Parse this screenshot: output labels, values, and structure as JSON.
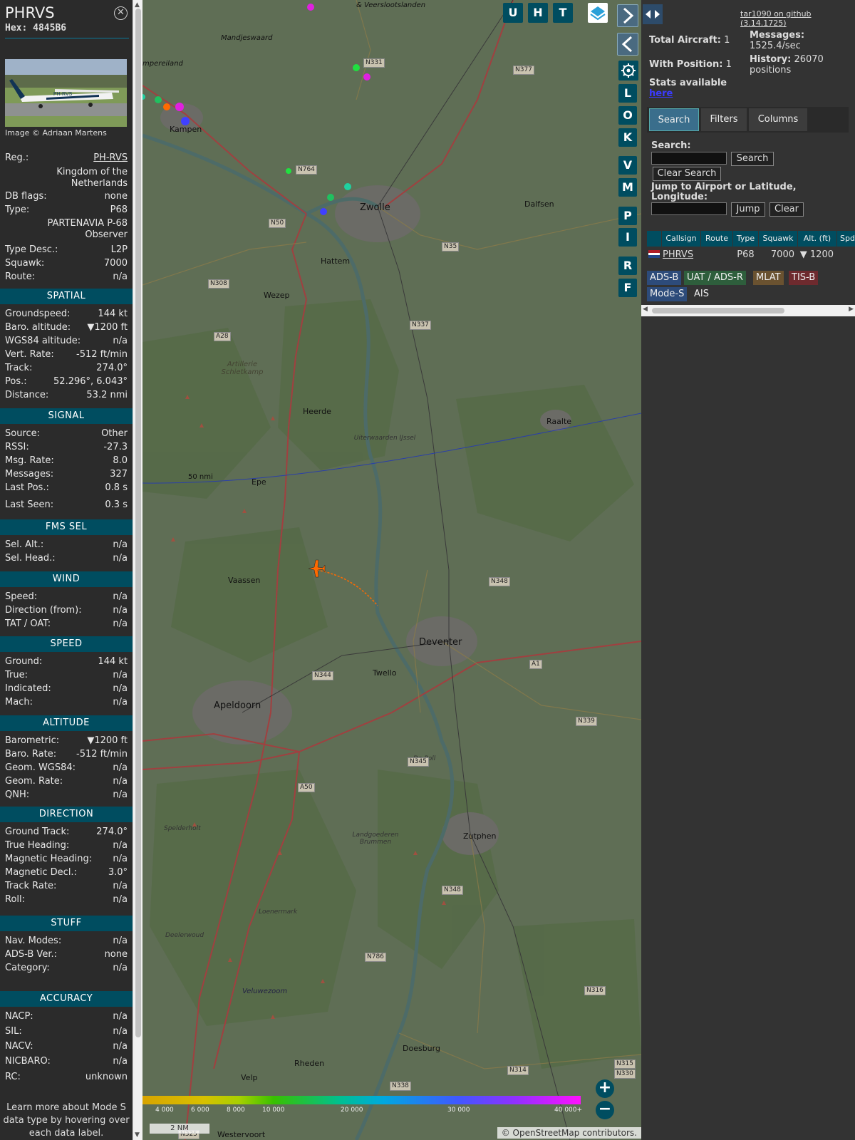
{
  "detail": {
    "title": "PHRVS",
    "hex_label": "Hex:",
    "hex": "4845B6",
    "image_credit": "Image © Adriaan Martens",
    "photo_text": "PH-RVS",
    "rows_top": [
      {
        "k": "Reg.:",
        "v": "PH-RVS"
      },
      {
        "k": "",
        "v": "Kingdom of the Netherlands"
      },
      {
        "k": "DB flags:",
        "v": "none"
      },
      {
        "k": "Type:",
        "v": "P68"
      },
      {
        "k": "",
        "v": "PARTENAVIA P-68 Observer"
      },
      {
        "k": "Type Desc.:",
        "v": "L2P"
      },
      {
        "k": "Squawk:",
        "v": "7000"
      },
      {
        "k": "Route:",
        "v": "n/a"
      }
    ],
    "sections": [
      {
        "title": "SPATIAL",
        "rows": [
          {
            "k": "Groundspeed:",
            "v": "144 kt"
          },
          {
            "k": "Baro. altitude:",
            "v": "▼1200 ft"
          },
          {
            "k": "WGS84 altitude:",
            "v": "n/a"
          },
          {
            "k": "Vert. Rate:",
            "v": "-512 ft/min"
          },
          {
            "k": "Track:",
            "v": "274.0°"
          },
          {
            "k": "Pos.:",
            "v": "52.296°, 6.043°"
          },
          {
            "k": "Distance:",
            "v": "53.2 nmi"
          }
        ]
      },
      {
        "title": "SIGNAL",
        "rows": [
          {
            "k": "Source:",
            "v": "Other"
          },
          {
            "k": "RSSI:",
            "v": "-27.3"
          },
          {
            "k": "Msg. Rate:",
            "v": "8.0"
          },
          {
            "k": "Messages:",
            "v": "327"
          },
          {
            "k": "Last Pos.:",
            "v": "0.8 s"
          },
          {
            "k": "Last Seen:",
            "v": "0.3 s"
          }
        ]
      },
      {
        "title": "FMS SEL",
        "rows": [
          {
            "k": "Sel. Alt.:",
            "v": "n/a"
          },
          {
            "k": "Sel. Head.:",
            "v": "n/a"
          }
        ]
      },
      {
        "title": "WIND",
        "rows": [
          {
            "k": "Speed:",
            "v": "n/a"
          },
          {
            "k": "Direction (from):",
            "v": "n/a"
          },
          {
            "k": "TAT / OAT:",
            "v": "n/a"
          }
        ]
      },
      {
        "title": "SPEED",
        "rows": [
          {
            "k": "Ground:",
            "v": "144 kt"
          },
          {
            "k": "True:",
            "v": "n/a"
          },
          {
            "k": "Indicated:",
            "v": "n/a"
          },
          {
            "k": "Mach:",
            "v": "n/a"
          }
        ]
      },
      {
        "title": "ALTITUDE",
        "rows": [
          {
            "k": "Barometric:",
            "v": "▼1200 ft"
          },
          {
            "k": "Baro. Rate:",
            "v": "-512 ft/min"
          },
          {
            "k": "Geom. WGS84:",
            "v": "n/a"
          },
          {
            "k": "Geom. Rate:",
            "v": "n/a"
          },
          {
            "k": "QNH:",
            "v": "n/a"
          }
        ]
      },
      {
        "title": "DIRECTION",
        "rows": [
          {
            "k": "Ground Track:",
            "v": "274.0°"
          },
          {
            "k": "True Heading:",
            "v": "n/a"
          },
          {
            "k": "Magnetic Heading:",
            "v": "n/a"
          },
          {
            "k": "Magnetic Decl.:",
            "v": "3.0°"
          },
          {
            "k": "Track Rate:",
            "v": "n/a"
          },
          {
            "k": "Roll:",
            "v": "n/a"
          }
        ]
      },
      {
        "title": "STUFF",
        "rows": [
          {
            "k": "Nav. Modes:",
            "v": "n/a"
          },
          {
            "k": "ADS-B Ver.:",
            "v": "none"
          },
          {
            "k": "Category:",
            "v": "n/a"
          }
        ]
      },
      {
        "title": "ACCURACY",
        "rows": [
          {
            "k": "NACP:",
            "v": "n/a"
          },
          {
            "k": "SIL:",
            "v": "n/a"
          },
          {
            "k": "NACV:",
            "v": "n/a"
          },
          {
            "k": "NICBARO:",
            "v": "n/a"
          },
          {
            "k": "RC:",
            "v": "unknown"
          }
        ]
      }
    ],
    "learn_more": "Learn more about Mode S data type by hovering over each data label."
  },
  "map": {
    "buttons_top": [
      "U",
      "H",
      "T"
    ],
    "buttons_side": [
      "L",
      "O",
      "K",
      "V",
      "M",
      "P",
      "I",
      "R",
      "F"
    ],
    "labels": {
      "zwolle": "Zwolle",
      "deventer": "Deventer",
      "apeldoorn": "Apeldoorn",
      "kampen": "Kampen",
      "hattem": "Hattem",
      "wezep": "Wezep",
      "heerde": "Heerde",
      "epe": "Epe",
      "vaassen": "Vaassen",
      "twello": "Twello",
      "zutphen": "Zutphen",
      "doesburg": "Doesburg",
      "dalfsen": "Dalfsen",
      "raalte": "Raalte",
      "velp": "Velp",
      "rheden": "Rheden",
      "westervoort": "Westervoort",
      "mandjeswaard": "Mandjeswaard",
      "veluwezoom": "Veluwezoom",
      "artillerie": "Artillerie Schietkamp",
      "kampereiland": "mpereiland",
      "veersloot": "& Veerslootslanden",
      "deelerwoud": "Deelerwoud",
      "loenermark": "Loenermark",
      "spelderholt": "Spelderholt",
      "landgoederen": "Landgoederen Brummen",
      "uiterwaarden": "Uiterwaarden IJssel",
      "depoll": "De Poll"
    },
    "roads": [
      "N331",
      "N377",
      "N764",
      "N50",
      "N35",
      "N308",
      "A28",
      "N337",
      "N348",
      "N344",
      "A1",
      "N339",
      "N345",
      "A50",
      "N348",
      "N786",
      "N316",
      "N315",
      "N330",
      "N314",
      "N338",
      "N325"
    ],
    "range_ring_label": "50 nmi",
    "colorbar_ticks": [
      "4 000",
      "6 000",
      "8 000",
      "10 000",
      "20 000",
      "30 000",
      "40 000+"
    ],
    "scale_label": "2 NM",
    "attribution_prefix": "© ",
    "attribution_link": "OpenStreetMap",
    "attribution_suffix": " contributors.",
    "zoom_in": "+",
    "zoom_out": "−"
  },
  "panel": {
    "version_link": "tar1090 on github (3.14.1725)",
    "total_aircraft_label": "Total Aircraft:",
    "total_aircraft": "1",
    "with_position_label": "With Position:",
    "with_position": "1",
    "messages_label": "Messages:",
    "messages_value": "1525.4/sec",
    "history_label": "History:",
    "history_value": "26070 positions",
    "stats_label": "Stats available",
    "stats_link": "here",
    "tabs": [
      "Search",
      "Filters",
      "Columns"
    ],
    "search_label": "Search:",
    "search_button": "Search",
    "clear_search_button": "Clear Search",
    "jump_label": "Jump to Airport or Latitude, Longitude:",
    "jump_button": "Jump",
    "clear_button": "Clear",
    "table": {
      "headers": [
        "Callsign",
        "Route",
        "Type",
        "Squawk",
        "Alt. (ft)",
        "Spd"
      ],
      "row": {
        "callsign": "PHRVS",
        "route": "",
        "type": "P68",
        "squawk": "7000",
        "alt": "▼ 1200"
      }
    },
    "legend": [
      {
        "label": "ADS-B",
        "color": "#2d4b7a"
      },
      {
        "label": "UAT / ADS-R",
        "color": "#2e5e3c"
      },
      {
        "label": "MLAT",
        "color": "#6a5230"
      },
      {
        "label": "TIS-B",
        "color": "#6e2a2e"
      },
      {
        "label": "Mode-S",
        "color": "#2d4b7a"
      },
      {
        "label": "AIS",
        "color": ""
      }
    ]
  }
}
